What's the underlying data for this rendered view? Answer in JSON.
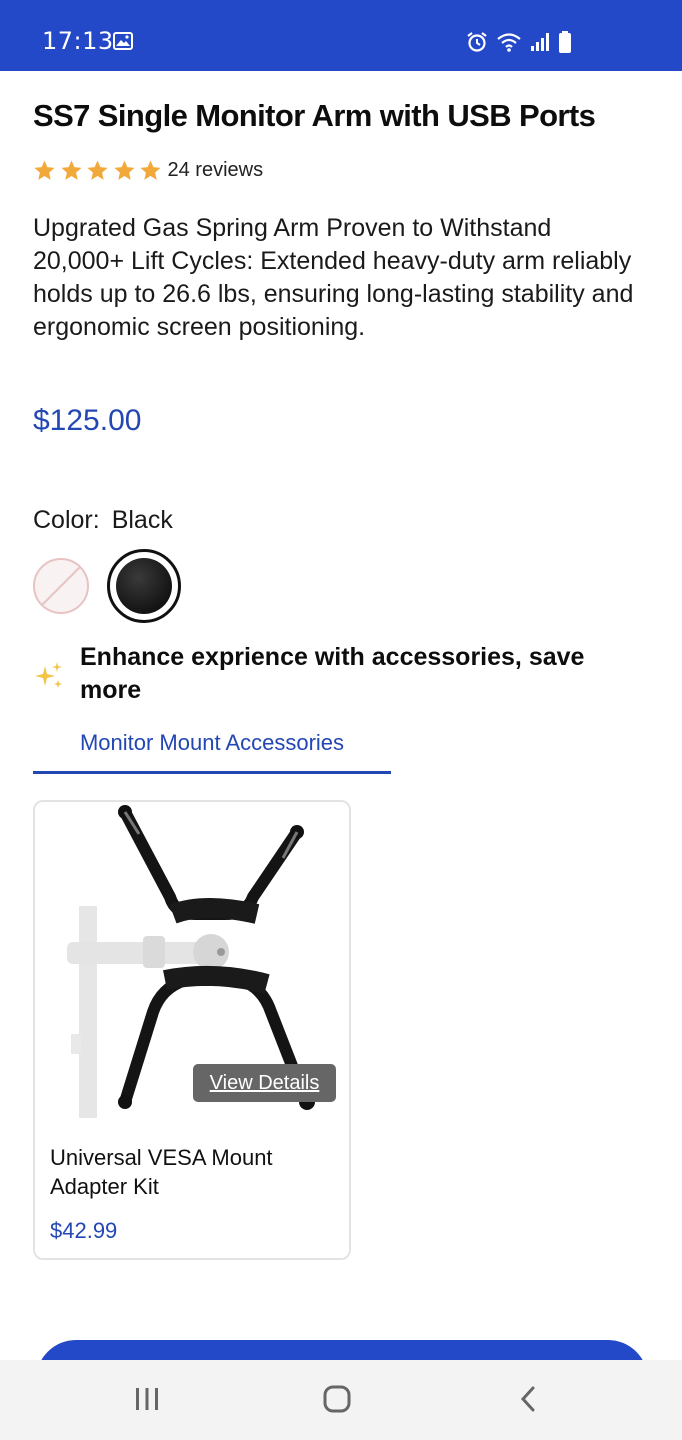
{
  "status_bar": {
    "time": "17:13",
    "background": "#2348c8",
    "icons": [
      "image-icon",
      "alarm-icon",
      "wifi-icon",
      "signal-icon",
      "battery-icon"
    ]
  },
  "product": {
    "title": "SS7 Single Monitor Arm with USB Ports",
    "rating": 5,
    "reviews": "24 reviews",
    "description": "Upgrated Gas Spring Arm Proven to Withstand 20,000+ Lift Cycles: Extended heavy-duty arm reliably holds up to 26.6 lbs, ensuring long-lasting stability and ergonomic screen positioning.",
    "price": "$125.00",
    "price_color": "#2347b3",
    "color_label": "Color:",
    "color_value": "Black",
    "swatches": [
      "white-unavailable",
      "black-selected"
    ]
  },
  "accessories": {
    "heading": "Enhance exprience with accessories, save more",
    "tab_label": "Monitor Mount Accessories",
    "items": [
      {
        "title": "Universal VESA Mount Adapter Kit",
        "price": "$42.99",
        "view_details": "View Details"
      }
    ]
  },
  "nav": {
    "icons": [
      "recent-apps-icon",
      "home-icon",
      "back-icon"
    ]
  }
}
